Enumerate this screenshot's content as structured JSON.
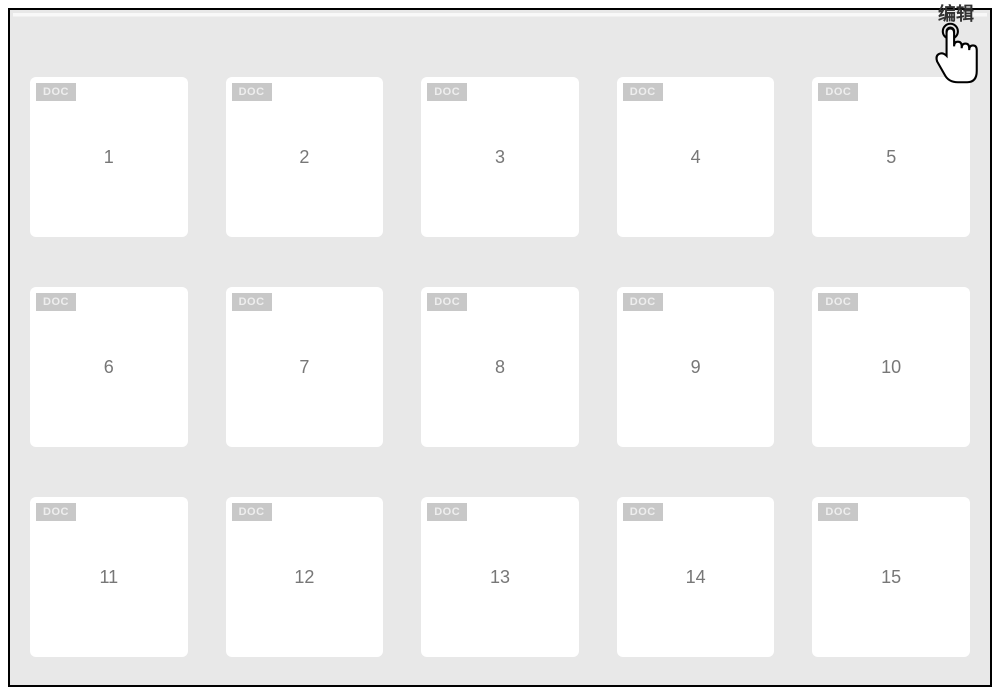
{
  "edit": {
    "label": "编辑"
  },
  "documents": [
    {
      "badge": "DOC",
      "number": "1"
    },
    {
      "badge": "DOC",
      "number": "2"
    },
    {
      "badge": "DOC",
      "number": "3"
    },
    {
      "badge": "DOC",
      "number": "4"
    },
    {
      "badge": "DOC",
      "number": "5"
    },
    {
      "badge": "DOC",
      "number": "6"
    },
    {
      "badge": "DOC",
      "number": "7"
    },
    {
      "badge": "DOC",
      "number": "8"
    },
    {
      "badge": "DOC",
      "number": "9"
    },
    {
      "badge": "DOC",
      "number": "10"
    },
    {
      "badge": "DOC",
      "number": "11"
    },
    {
      "badge": "DOC",
      "number": "12"
    },
    {
      "badge": "DOC",
      "number": "13"
    },
    {
      "badge": "DOC",
      "number": "14"
    },
    {
      "badge": "DOC",
      "number": "15"
    }
  ]
}
